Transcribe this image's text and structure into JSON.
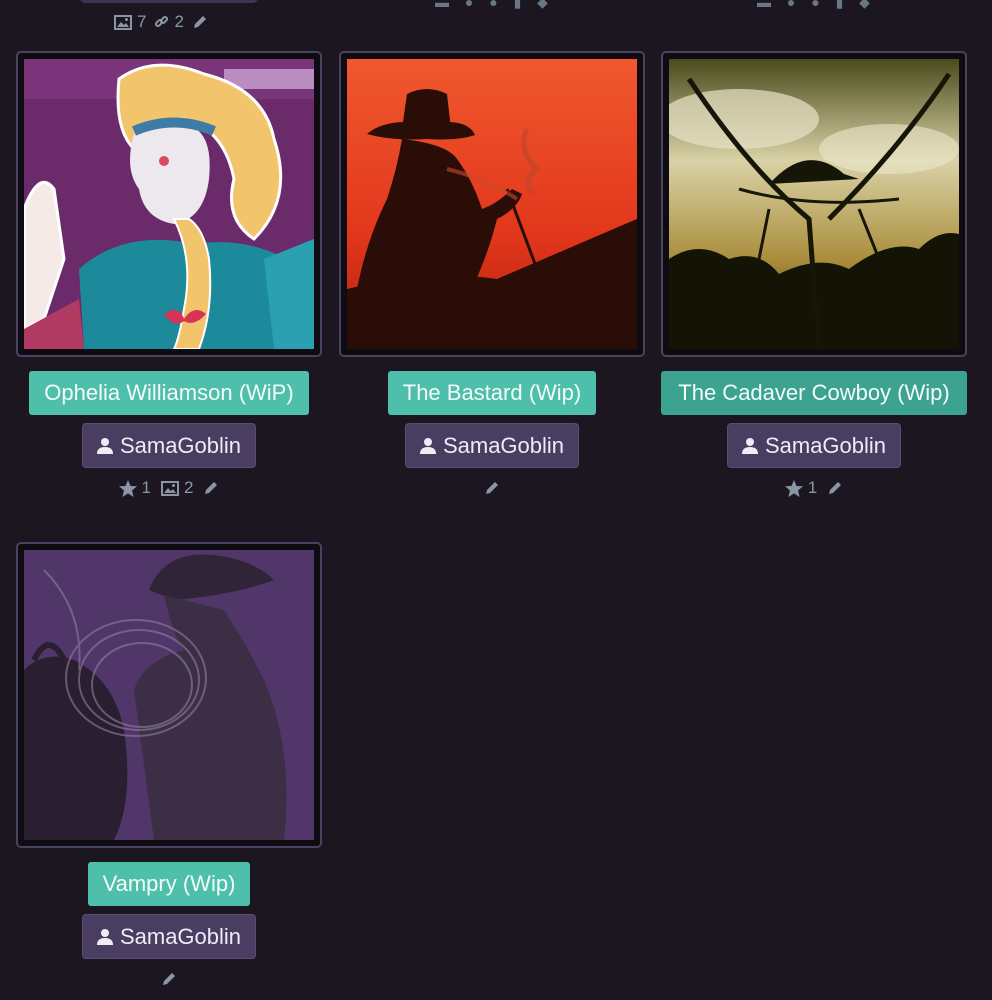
{
  "top_stats": {
    "images": "7",
    "links": "2"
  },
  "cards": [
    {
      "title": "Ophelia Williamson (WiP)",
      "author": "SamaGoblin",
      "stars": "1",
      "images": "2"
    },
    {
      "title": "The Bastard (Wip)",
      "author": "SamaGoblin"
    },
    {
      "title": "The Cadaver Cowboy (Wip)",
      "author": "SamaGoblin",
      "stars": "1"
    },
    {
      "title": "Vampry (Wip)",
      "author": "SamaGoblin"
    }
  ],
  "colors": {
    "background": "#1c1620",
    "title_button": "#4dbfaa",
    "author_button": "#4a3d62",
    "stat_text": "#8a96a6"
  },
  "icons": [
    "user-icon",
    "star-icon",
    "image-icon",
    "link-icon",
    "pencil-icon"
  ]
}
